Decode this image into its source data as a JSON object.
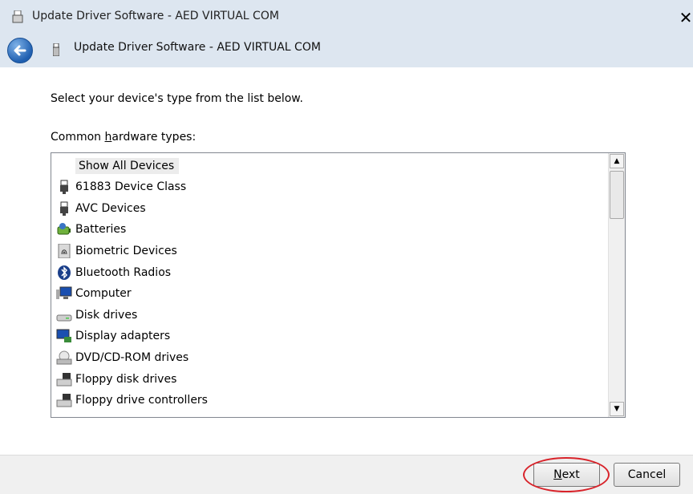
{
  "window": {
    "title": "Update Driver Software - AED VIRTUAL COM"
  },
  "nav": {
    "title": "Update Driver Software - AED VIRTUAL COM"
  },
  "content": {
    "instruction": "Select your device's type from the list below.",
    "list_label_pre": "Common ",
    "list_label_accel": "h",
    "list_label_post": "ardware types:"
  },
  "devices": {
    "items": [
      {
        "label": "Show All Devices",
        "icon": "none-icon"
      },
      {
        "label": "61883 Device Class",
        "icon": "usb-connector-icon"
      },
      {
        "label": "AVC Devices",
        "icon": "usb-connector-icon"
      },
      {
        "label": "Batteries",
        "icon": "battery-icon"
      },
      {
        "label": "Biometric Devices",
        "icon": "fingerprint-icon"
      },
      {
        "label": "Bluetooth Radios",
        "icon": "bluetooth-icon"
      },
      {
        "label": "Computer",
        "icon": "computer-icon"
      },
      {
        "label": "Disk drives",
        "icon": "disk-drive-icon"
      },
      {
        "label": "Display adapters",
        "icon": "display-adapter-icon"
      },
      {
        "label": "DVD/CD-ROM drives",
        "icon": "dvd-drive-icon"
      },
      {
        "label": "Floppy disk drives",
        "icon": "floppy-drive-icon"
      },
      {
        "label": "Floppy drive controllers",
        "icon": "floppy-controller-icon"
      }
    ]
  },
  "buttons": {
    "next_accel": "N",
    "next_rest": "ext",
    "cancel": "Cancel"
  },
  "colors": {
    "annotation": "#d8232a",
    "accent": "#1f5fb0"
  }
}
